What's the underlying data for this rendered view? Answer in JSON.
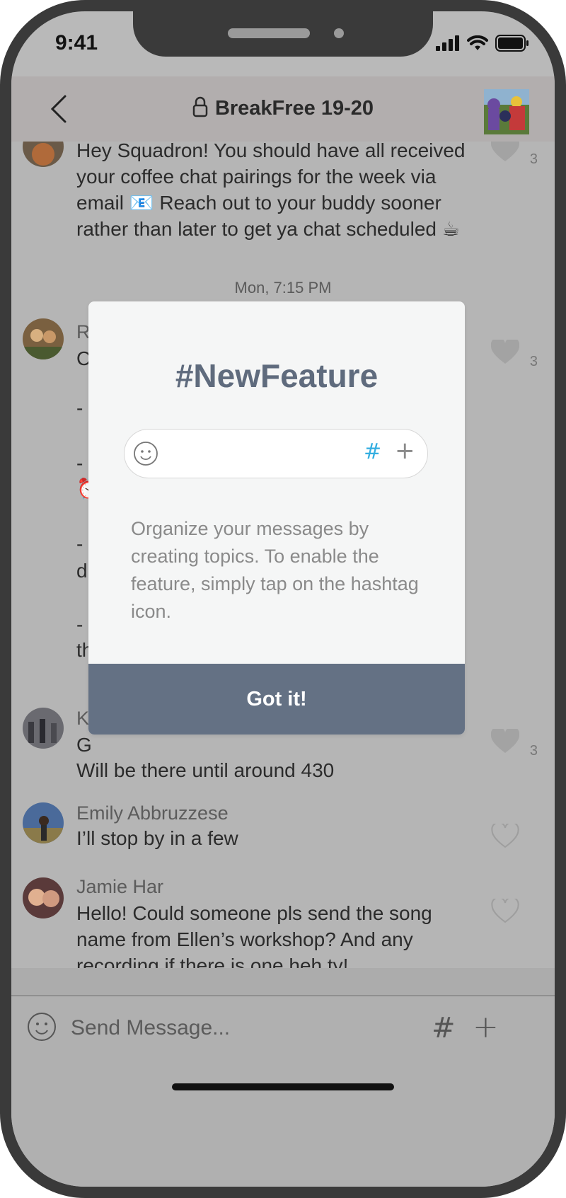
{
  "status_bar": {
    "time": "9:41"
  },
  "nav": {
    "title": "BreakFree 19-20"
  },
  "messages": [
    {
      "text": "Hey Squadron! You should have all received your coffee chat pairings for the week via email 📧 Reach out to your buddy sooner rather than later to get ya chat scheduled ☕",
      "likes": "3"
    },
    {
      "sender": "R",
      "text": "C",
      "likes": "3"
    },
    {
      "sender": "Ky",
      "text": "G",
      "text2": "Will be there until around 430",
      "likes": "3"
    },
    {
      "sender": "Emily Abbruzzese",
      "text": "I’ll stop by in a few"
    },
    {
      "sender": "Jamie Har",
      "text": "Hello! Could someone pls send the song name from Ellen’s workshop? And any recording if there is one heh ty!"
    }
  ],
  "partial_fragments": [
    "-",
    "-",
    "⏰",
    "-",
    "d",
    "-",
    "th"
  ],
  "timestamp": "Mon, 7:15 PM",
  "composer": {
    "placeholder": "Send Message...",
    "hash": "#",
    "plus": "+"
  },
  "modal": {
    "title": "#NewFeature",
    "hash": "#",
    "plus": "+",
    "description": "Organize your messages by creating topics. To enable the feature, simply tap on the hashtag icon.",
    "button": "Got it!"
  },
  "colors": {
    "modal_button": "#647184",
    "hash_accent": "#34aee0",
    "title": "#5f6b7d"
  }
}
